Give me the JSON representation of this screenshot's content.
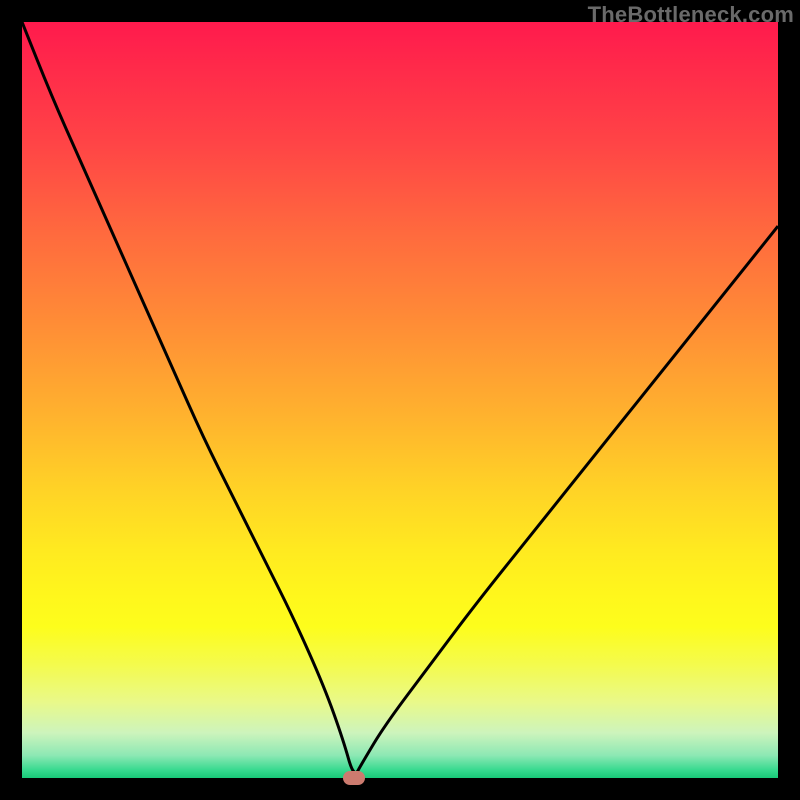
{
  "watermark": "TheBottleneck.com",
  "colors": {
    "frame_bg": "#000000",
    "curve": "#000000",
    "marker": "#cc7b6f"
  },
  "chart_data": {
    "type": "line",
    "title": "",
    "xlabel": "",
    "ylabel": "",
    "xlim": [
      0,
      100
    ],
    "ylim": [
      0,
      100
    ],
    "grid": false,
    "legend": false,
    "series": [
      {
        "name": "bottleneck-curve",
        "x": [
          0,
          4,
          8,
          12,
          16,
          20,
          24,
          28,
          32,
          36,
          40,
          42.5,
          43.9,
          45,
          48,
          54,
          60,
          68,
          76,
          84,
          92,
          100
        ],
        "values": [
          100,
          90,
          81,
          72,
          63,
          54,
          45,
          37,
          29,
          21,
          12,
          5,
          0,
          2,
          7,
          15,
          23,
          33,
          43,
          53,
          63,
          73
        ]
      }
    ],
    "marker": {
      "x": 43.9,
      "y": 0
    }
  }
}
